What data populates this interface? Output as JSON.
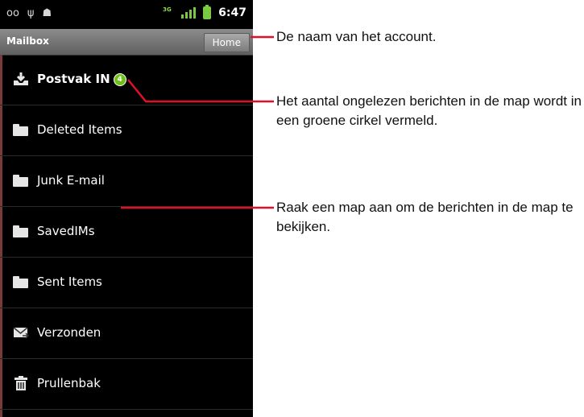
{
  "status_bar": {
    "time": "6:47",
    "icons": [
      "voicemail-icon",
      "usb-icon",
      "android-debug-icon",
      "3g-data-icon",
      "signal-icon",
      "battery-icon"
    ]
  },
  "title_bar": {
    "title": "Mailbox",
    "home_label": "Home"
  },
  "folders": [
    {
      "label": "Postvak IN",
      "icon": "inbox-download-icon",
      "unread": "4",
      "bold": true
    },
    {
      "label": "Deleted Items",
      "icon": "folder-icon"
    },
    {
      "label": "Junk E-mail",
      "icon": "folder-icon"
    },
    {
      "label": "SavedIMs",
      "icon": "folder-icon"
    },
    {
      "label": "Sent Items",
      "icon": "folder-icon"
    },
    {
      "label": "Verzonden",
      "icon": "sent-mail-icon"
    },
    {
      "label": "Prullenbak",
      "icon": "trash-icon"
    }
  ],
  "annotations": {
    "account": "De naam van het account.",
    "unread": "Het aantal ongelezen berichten in de map wordt in een groene cirkel vermeld.",
    "touch": "Raak een map aan om de berichten in de map te bekijken."
  },
  "colors": {
    "leader_line": "#e0102a",
    "badge": "#6fbf1a",
    "signal": "#7ac943"
  }
}
